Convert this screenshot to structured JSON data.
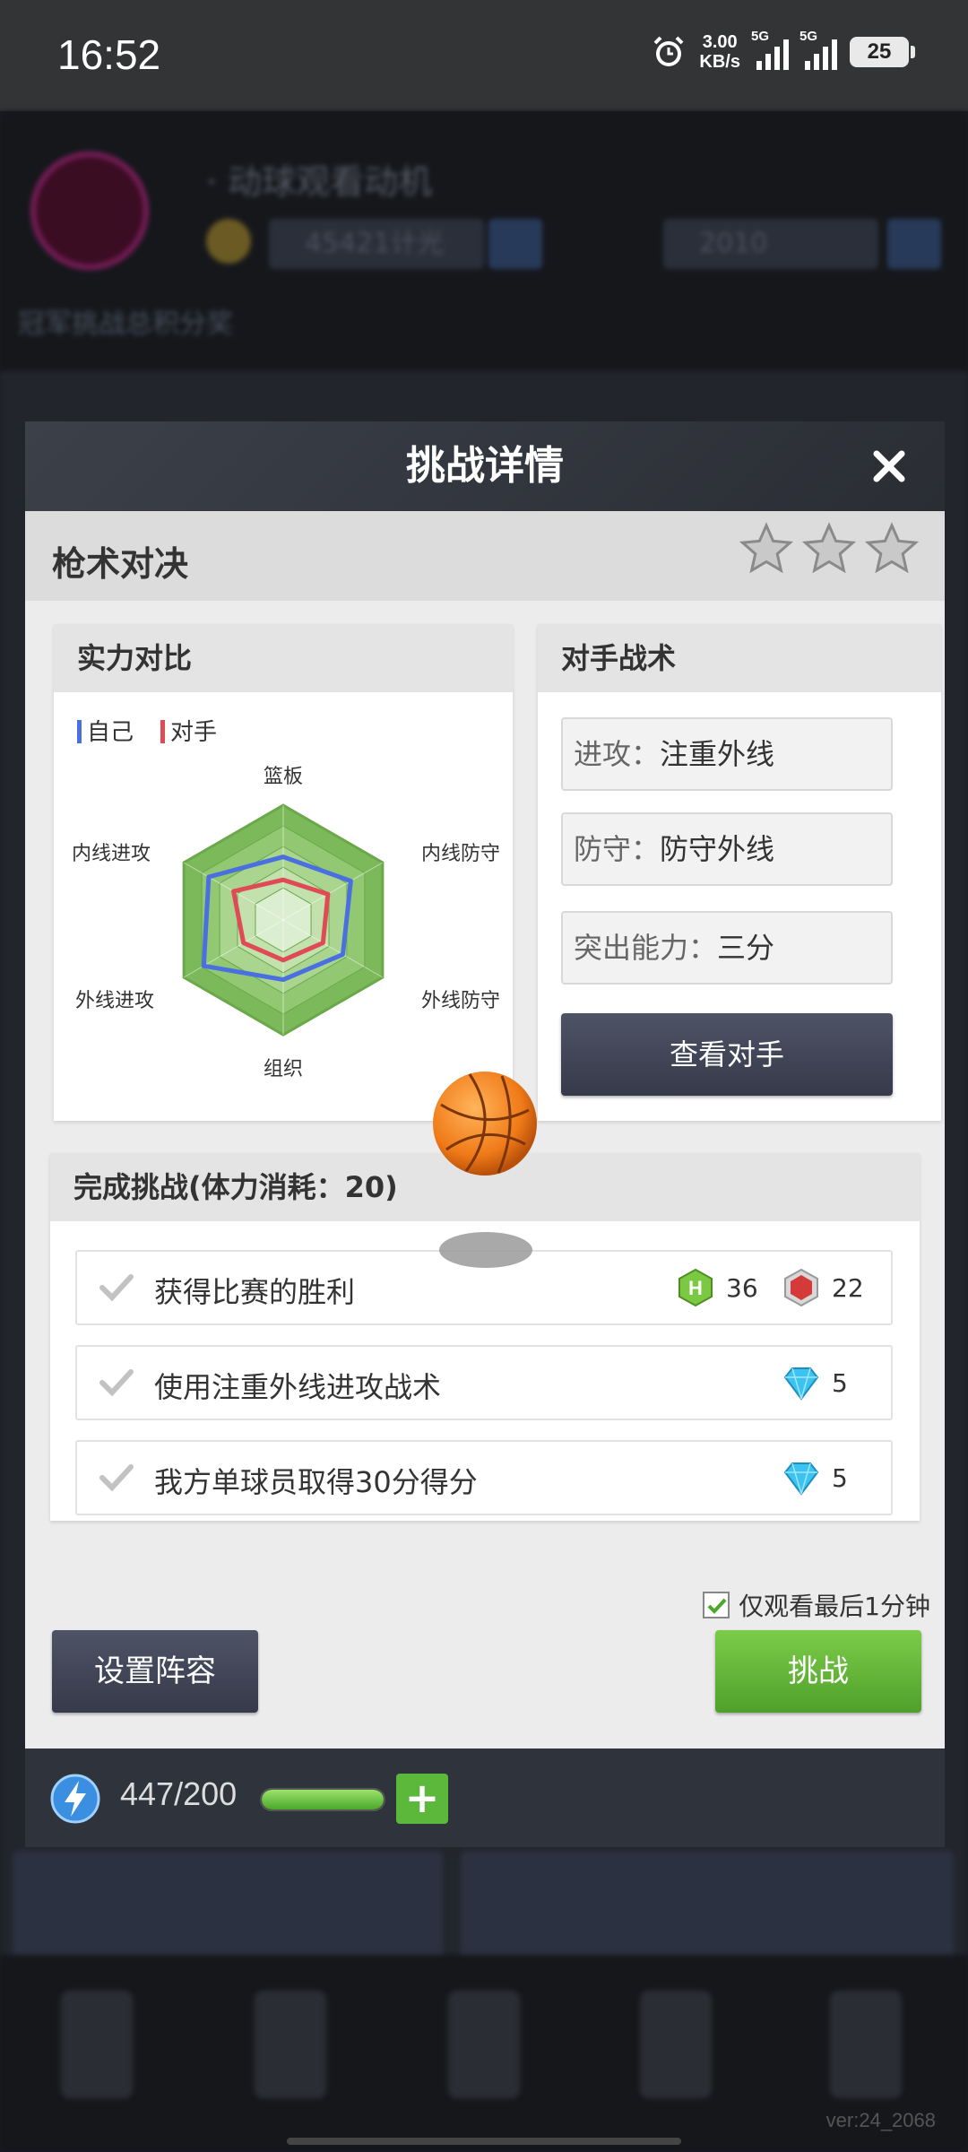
{
  "status_bar": {
    "time": "16:52",
    "net_speed_value": "3.00",
    "net_speed_unit": "KB/s",
    "sim1_label": "5G",
    "sim2_label": "5G",
    "battery": "25"
  },
  "background": {
    "player_name": "· 动球观看动机",
    "coins": "45421计光",
    "gems": "2010",
    "status_line": "冠军挑战总积分奖"
  },
  "dialog": {
    "title": "挑战详情",
    "mode_title": "枪术对决",
    "stars_earned": 0,
    "stars_total": 3,
    "strength_panel": {
      "title": "实力对比",
      "legend_self": "自己",
      "legend_opponent": "对手",
      "self_color": "#4a6fe0",
      "opponent_color": "#e04a55",
      "axes": [
        "篮板",
        "内线防守",
        "外线防守",
        "组织",
        "外线进攻",
        "内线进攻"
      ],
      "self_values": [
        0.55,
        0.68,
        0.6,
        0.52,
        0.8,
        0.75
      ],
      "opponent_values": [
        0.35,
        0.45,
        0.4,
        0.35,
        0.4,
        0.5
      ]
    },
    "tactics_panel": {
      "title": "对手战术",
      "attack_key": "进攻：",
      "attack_value": "注重外线",
      "defense_key": "防守：",
      "defense_value": "防守外线",
      "highlight_key": "突出能力：",
      "highlight_value": "三分",
      "view_button": "查看对手"
    },
    "tasks_panel": {
      "title": "完成挑战(体力消耗：20)",
      "tasks": [
        {
          "text": "获得比赛的胜利",
          "rewards": [
            {
              "icon": "h-coin-icon",
              "amount": "36"
            },
            {
              "icon": "exp-icon",
              "amount": "22"
            }
          ]
        },
        {
          "text": "使用注重外线进攻战术",
          "rewards": [
            {
              "icon": "diamond-icon",
              "amount": "5"
            }
          ]
        },
        {
          "text": "我方单球员取得30分得分",
          "rewards": [
            {
              "icon": "diamond-icon",
              "amount": "5"
            }
          ]
        }
      ]
    },
    "watch_last_minute": "仅观看最后1分钟",
    "setup_button": "设置阵容",
    "challenge_button": "挑战"
  },
  "energy": {
    "text": "447/200",
    "fill_fraction": 1.0
  },
  "version": "ver:24_2068"
}
